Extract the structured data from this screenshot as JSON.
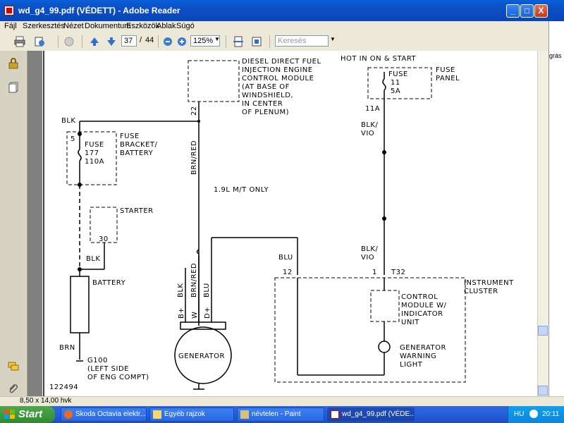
{
  "window": {
    "title": "wd_g4_99.pdf (VÉDETT) - Adobe Reader",
    "buttons": {
      "minimize": "_",
      "maximize": "□",
      "close": "X"
    }
  },
  "menu": [
    "Fájl",
    "Szerkesztés",
    "Nézet",
    "Dokumentum",
    "Eszközök",
    "Ablak",
    "Súgó"
  ],
  "toolbar": {
    "page_current": "37",
    "page_separator": "/",
    "page_total": "44",
    "zoom": "125%",
    "search_placeholder": "Keresés"
  },
  "right_strip": {
    "text": "grás"
  },
  "status": {
    "page_size": "8,50 x 14,00 hvk"
  },
  "diagram": {
    "diesel_module": [
      "DIESEL DIRECT FUEL",
      "INJECTION ENGINE",
      "CONTROL MODULE",
      "(AT BASE OF",
      "WINDSHIELD,",
      "IN CENTER",
      "OF PLENUM)"
    ],
    "hot_in": "HOT IN ON & START",
    "fuse_panel": [
      "FUSE",
      "PANEL"
    ],
    "fuse11": [
      "FUSE",
      "11",
      "5A"
    ],
    "pin_11a": "11A",
    "blk_vio_1": [
      "BLK/",
      "VIO"
    ],
    "blk_vio_2": [
      "BLK/",
      "VIO"
    ],
    "blk_top": "BLK",
    "fuse177_pin": "5",
    "fuse177": [
      "FUSE",
      "177",
      "110A"
    ],
    "fuse_bracket": [
      "FUSE",
      "BRACKET/",
      "BATTERY"
    ],
    "pin_22": "22",
    "brn_red_1": "BRN/RED",
    "only_note": "1.9L M/T ONLY",
    "starter": "STARTER",
    "pin_30": "30",
    "blk_mid": "BLK",
    "battery": "BATTERY",
    "brn_red_2": "BRN/RED",
    "blk_gen": "BLK",
    "blu_gen": "BLU",
    "blu_right": "BLU",
    "blk_vio_lower": [
      "BLK/",
      "VIO"
    ],
    "pin_12": "12",
    "pin_1": "1",
    "t32": "T32",
    "instrument_cluster": [
      "INSTRUMENT",
      "CLUSTER"
    ],
    "control_module": [
      "CONTROL",
      "MODULE W/",
      "INDICATOR",
      "UNIT"
    ],
    "gen_light": [
      "GENERATOR",
      "WARNING",
      "LIGHT"
    ],
    "gen_terminals": [
      "B+",
      "W",
      "D+"
    ],
    "generator": "GENERATOR",
    "brn": "BRN",
    "g100": [
      "G100",
      "(LEFT SIDE",
      "OF ENG COMPT)"
    ],
    "fig_no": "122494"
  },
  "taskbar": {
    "start": "Start",
    "tasks": [
      "Skoda Octavia elektr...",
      "Egyéb rajzok",
      "névtelen - Paint",
      "wd_g4_99.pdf (VÉDE..."
    ],
    "lang": "HU",
    "time": "20:11"
  }
}
